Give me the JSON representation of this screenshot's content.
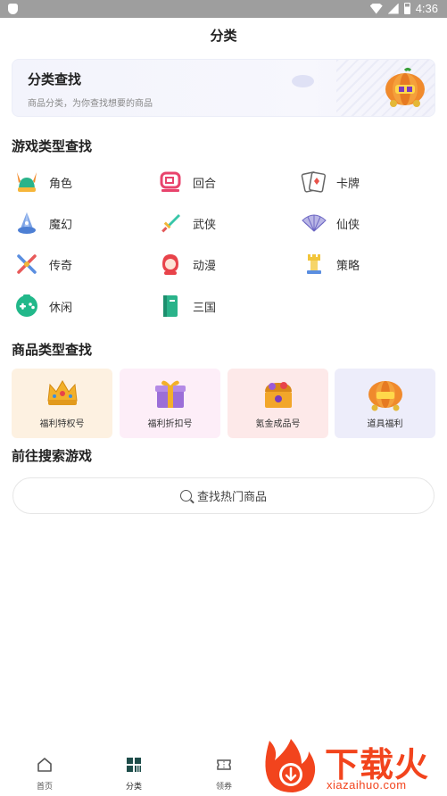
{
  "status": {
    "time": "4:36"
  },
  "page_title": "分类",
  "banner": {
    "title": "分类查找",
    "subtitle": "商品分类，为你查找想要的商品"
  },
  "game_section": {
    "title": "游戏类型查找",
    "items": [
      {
        "label": "角色",
        "icon": "viking-helmet-icon"
      },
      {
        "label": "回合",
        "icon": "turn-icon"
      },
      {
        "label": "卡牌",
        "icon": "cards-icon"
      },
      {
        "label": "魔幻",
        "icon": "wizard-icon"
      },
      {
        "label": "武侠",
        "icon": "sword-icon"
      },
      {
        "label": "仙侠",
        "icon": "fan-icon"
      },
      {
        "label": "传奇",
        "icon": "crossed-swords-icon"
      },
      {
        "label": "动漫",
        "icon": "anime-girl-icon"
      },
      {
        "label": "策略",
        "icon": "chess-tower-icon"
      },
      {
        "label": "休闲",
        "icon": "gamepad-icon"
      },
      {
        "label": "三国",
        "icon": "book-icon"
      }
    ]
  },
  "goods_section": {
    "title": "商品类型查找",
    "items": [
      {
        "label": "福利特权号",
        "bg": "#fdf1e1",
        "icon": "crown-icon"
      },
      {
        "label": "福利折扣号",
        "bg": "#fdeef8",
        "icon": "gift-box-icon"
      },
      {
        "label": "氪金成品号",
        "bg": "#fde9e9",
        "icon": "treasure-chest-icon"
      },
      {
        "label": "道具福利",
        "bg": "#ededfa",
        "icon": "pumpkin-carriage-icon"
      }
    ]
  },
  "search_section": {
    "title": "前往搜索游戏",
    "placeholder": "查找热门商品"
  },
  "tabs": [
    {
      "label": "首页",
      "icon": "home-icon"
    },
    {
      "label": "分类",
      "icon": "category-icon"
    },
    {
      "label": "领券",
      "icon": "coupon-icon"
    }
  ],
  "watermark": {
    "text": "下载火",
    "url": "xiazaihuo.com"
  },
  "colors": {
    "accent_green": "#1aa67a",
    "watermark": "#f2441d"
  }
}
